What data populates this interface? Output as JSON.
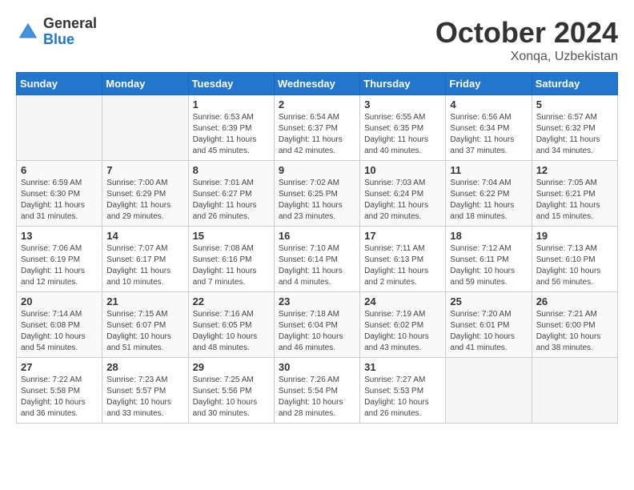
{
  "header": {
    "logo_general": "General",
    "logo_blue": "Blue",
    "month_title": "October 2024",
    "location": "Xonqa, Uzbekistan"
  },
  "days_of_week": [
    "Sunday",
    "Monday",
    "Tuesday",
    "Wednesday",
    "Thursday",
    "Friday",
    "Saturday"
  ],
  "weeks": [
    [
      {
        "day": "",
        "sunrise": "",
        "sunset": "",
        "daylight": "",
        "empty": true
      },
      {
        "day": "",
        "sunrise": "",
        "sunset": "",
        "daylight": "",
        "empty": true
      },
      {
        "day": "1",
        "sunrise": "Sunrise: 6:53 AM",
        "sunset": "Sunset: 6:39 PM",
        "daylight": "Daylight: 11 hours and 45 minutes.",
        "empty": false
      },
      {
        "day": "2",
        "sunrise": "Sunrise: 6:54 AM",
        "sunset": "Sunset: 6:37 PM",
        "daylight": "Daylight: 11 hours and 42 minutes.",
        "empty": false
      },
      {
        "day": "3",
        "sunrise": "Sunrise: 6:55 AM",
        "sunset": "Sunset: 6:35 PM",
        "daylight": "Daylight: 11 hours and 40 minutes.",
        "empty": false
      },
      {
        "day": "4",
        "sunrise": "Sunrise: 6:56 AM",
        "sunset": "Sunset: 6:34 PM",
        "daylight": "Daylight: 11 hours and 37 minutes.",
        "empty": false
      },
      {
        "day": "5",
        "sunrise": "Sunrise: 6:57 AM",
        "sunset": "Sunset: 6:32 PM",
        "daylight": "Daylight: 11 hours and 34 minutes.",
        "empty": false
      }
    ],
    [
      {
        "day": "6",
        "sunrise": "Sunrise: 6:59 AM",
        "sunset": "Sunset: 6:30 PM",
        "daylight": "Daylight: 11 hours and 31 minutes.",
        "empty": false
      },
      {
        "day": "7",
        "sunrise": "Sunrise: 7:00 AM",
        "sunset": "Sunset: 6:29 PM",
        "daylight": "Daylight: 11 hours and 29 minutes.",
        "empty": false
      },
      {
        "day": "8",
        "sunrise": "Sunrise: 7:01 AM",
        "sunset": "Sunset: 6:27 PM",
        "daylight": "Daylight: 11 hours and 26 minutes.",
        "empty": false
      },
      {
        "day": "9",
        "sunrise": "Sunrise: 7:02 AM",
        "sunset": "Sunset: 6:25 PM",
        "daylight": "Daylight: 11 hours and 23 minutes.",
        "empty": false
      },
      {
        "day": "10",
        "sunrise": "Sunrise: 7:03 AM",
        "sunset": "Sunset: 6:24 PM",
        "daylight": "Daylight: 11 hours and 20 minutes.",
        "empty": false
      },
      {
        "day": "11",
        "sunrise": "Sunrise: 7:04 AM",
        "sunset": "Sunset: 6:22 PM",
        "daylight": "Daylight: 11 hours and 18 minutes.",
        "empty": false
      },
      {
        "day": "12",
        "sunrise": "Sunrise: 7:05 AM",
        "sunset": "Sunset: 6:21 PM",
        "daylight": "Daylight: 11 hours and 15 minutes.",
        "empty": false
      }
    ],
    [
      {
        "day": "13",
        "sunrise": "Sunrise: 7:06 AM",
        "sunset": "Sunset: 6:19 PM",
        "daylight": "Daylight: 11 hours and 12 minutes.",
        "empty": false
      },
      {
        "day": "14",
        "sunrise": "Sunrise: 7:07 AM",
        "sunset": "Sunset: 6:17 PM",
        "daylight": "Daylight: 11 hours and 10 minutes.",
        "empty": false
      },
      {
        "day": "15",
        "sunrise": "Sunrise: 7:08 AM",
        "sunset": "Sunset: 6:16 PM",
        "daylight": "Daylight: 11 hours and 7 minutes.",
        "empty": false
      },
      {
        "day": "16",
        "sunrise": "Sunrise: 7:10 AM",
        "sunset": "Sunset: 6:14 PM",
        "daylight": "Daylight: 11 hours and 4 minutes.",
        "empty": false
      },
      {
        "day": "17",
        "sunrise": "Sunrise: 7:11 AM",
        "sunset": "Sunset: 6:13 PM",
        "daylight": "Daylight: 11 hours and 2 minutes.",
        "empty": false
      },
      {
        "day": "18",
        "sunrise": "Sunrise: 7:12 AM",
        "sunset": "Sunset: 6:11 PM",
        "daylight": "Daylight: 10 hours and 59 minutes.",
        "empty": false
      },
      {
        "day": "19",
        "sunrise": "Sunrise: 7:13 AM",
        "sunset": "Sunset: 6:10 PM",
        "daylight": "Daylight: 10 hours and 56 minutes.",
        "empty": false
      }
    ],
    [
      {
        "day": "20",
        "sunrise": "Sunrise: 7:14 AM",
        "sunset": "Sunset: 6:08 PM",
        "daylight": "Daylight: 10 hours and 54 minutes.",
        "empty": false
      },
      {
        "day": "21",
        "sunrise": "Sunrise: 7:15 AM",
        "sunset": "Sunset: 6:07 PM",
        "daylight": "Daylight: 10 hours and 51 minutes.",
        "empty": false
      },
      {
        "day": "22",
        "sunrise": "Sunrise: 7:16 AM",
        "sunset": "Sunset: 6:05 PM",
        "daylight": "Daylight: 10 hours and 48 minutes.",
        "empty": false
      },
      {
        "day": "23",
        "sunrise": "Sunrise: 7:18 AM",
        "sunset": "Sunset: 6:04 PM",
        "daylight": "Daylight: 10 hours and 46 minutes.",
        "empty": false
      },
      {
        "day": "24",
        "sunrise": "Sunrise: 7:19 AM",
        "sunset": "Sunset: 6:02 PM",
        "daylight": "Daylight: 10 hours and 43 minutes.",
        "empty": false
      },
      {
        "day": "25",
        "sunrise": "Sunrise: 7:20 AM",
        "sunset": "Sunset: 6:01 PM",
        "daylight": "Daylight: 10 hours and 41 minutes.",
        "empty": false
      },
      {
        "day": "26",
        "sunrise": "Sunrise: 7:21 AM",
        "sunset": "Sunset: 6:00 PM",
        "daylight": "Daylight: 10 hours and 38 minutes.",
        "empty": false
      }
    ],
    [
      {
        "day": "27",
        "sunrise": "Sunrise: 7:22 AM",
        "sunset": "Sunset: 5:58 PM",
        "daylight": "Daylight: 10 hours and 36 minutes.",
        "empty": false
      },
      {
        "day": "28",
        "sunrise": "Sunrise: 7:23 AM",
        "sunset": "Sunset: 5:57 PM",
        "daylight": "Daylight: 10 hours and 33 minutes.",
        "empty": false
      },
      {
        "day": "29",
        "sunrise": "Sunrise: 7:25 AM",
        "sunset": "Sunset: 5:56 PM",
        "daylight": "Daylight: 10 hours and 30 minutes.",
        "empty": false
      },
      {
        "day": "30",
        "sunrise": "Sunrise: 7:26 AM",
        "sunset": "Sunset: 5:54 PM",
        "daylight": "Daylight: 10 hours and 28 minutes.",
        "empty": false
      },
      {
        "day": "31",
        "sunrise": "Sunrise: 7:27 AM",
        "sunset": "Sunset: 5:53 PM",
        "daylight": "Daylight: 10 hours and 26 minutes.",
        "empty": false
      },
      {
        "day": "",
        "sunrise": "",
        "sunset": "",
        "daylight": "",
        "empty": true
      },
      {
        "day": "",
        "sunrise": "",
        "sunset": "",
        "daylight": "",
        "empty": true
      }
    ]
  ]
}
